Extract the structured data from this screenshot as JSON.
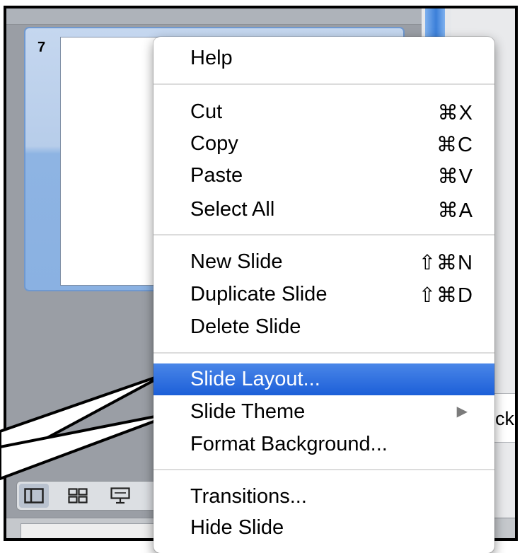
{
  "slide_panel": {
    "slide_number": "7"
  },
  "context_menu": {
    "items": [
      {
        "label": "Help",
        "shortcut": ""
      },
      {
        "label": "Cut",
        "shortcut": "⌘X"
      },
      {
        "label": "Copy",
        "shortcut": "⌘C"
      },
      {
        "label": "Paste",
        "shortcut": "⌘V"
      },
      {
        "label": "Select All",
        "shortcut": "⌘A"
      },
      {
        "label": "New Slide",
        "shortcut": "⇧⌘N"
      },
      {
        "label": "Duplicate Slide",
        "shortcut": "⇧⌘D"
      },
      {
        "label": "Delete Slide",
        "shortcut": ""
      },
      {
        "label": "Slide Layout...",
        "shortcut": ""
      },
      {
        "label": "Slide Theme",
        "shortcut": ""
      },
      {
        "label": "Format Background...",
        "shortcut": ""
      },
      {
        "label": "Transitions...",
        "shortcut": ""
      },
      {
        "label": "Hide Slide",
        "shortcut": ""
      }
    ],
    "highlighted_item": "Slide Layout...",
    "submenu_arrow_icon": "triangle-right-icon"
  },
  "partial_button": {
    "label": "ick"
  },
  "view_buttons": [
    {
      "icon": "normal-view-icon"
    },
    {
      "icon": "slide-sorter-view-icon"
    },
    {
      "icon": "slide-show-view-icon"
    }
  ],
  "colors": {
    "menu_highlight": "#1c5fd8",
    "selection_blue": "#8ab1e2"
  }
}
